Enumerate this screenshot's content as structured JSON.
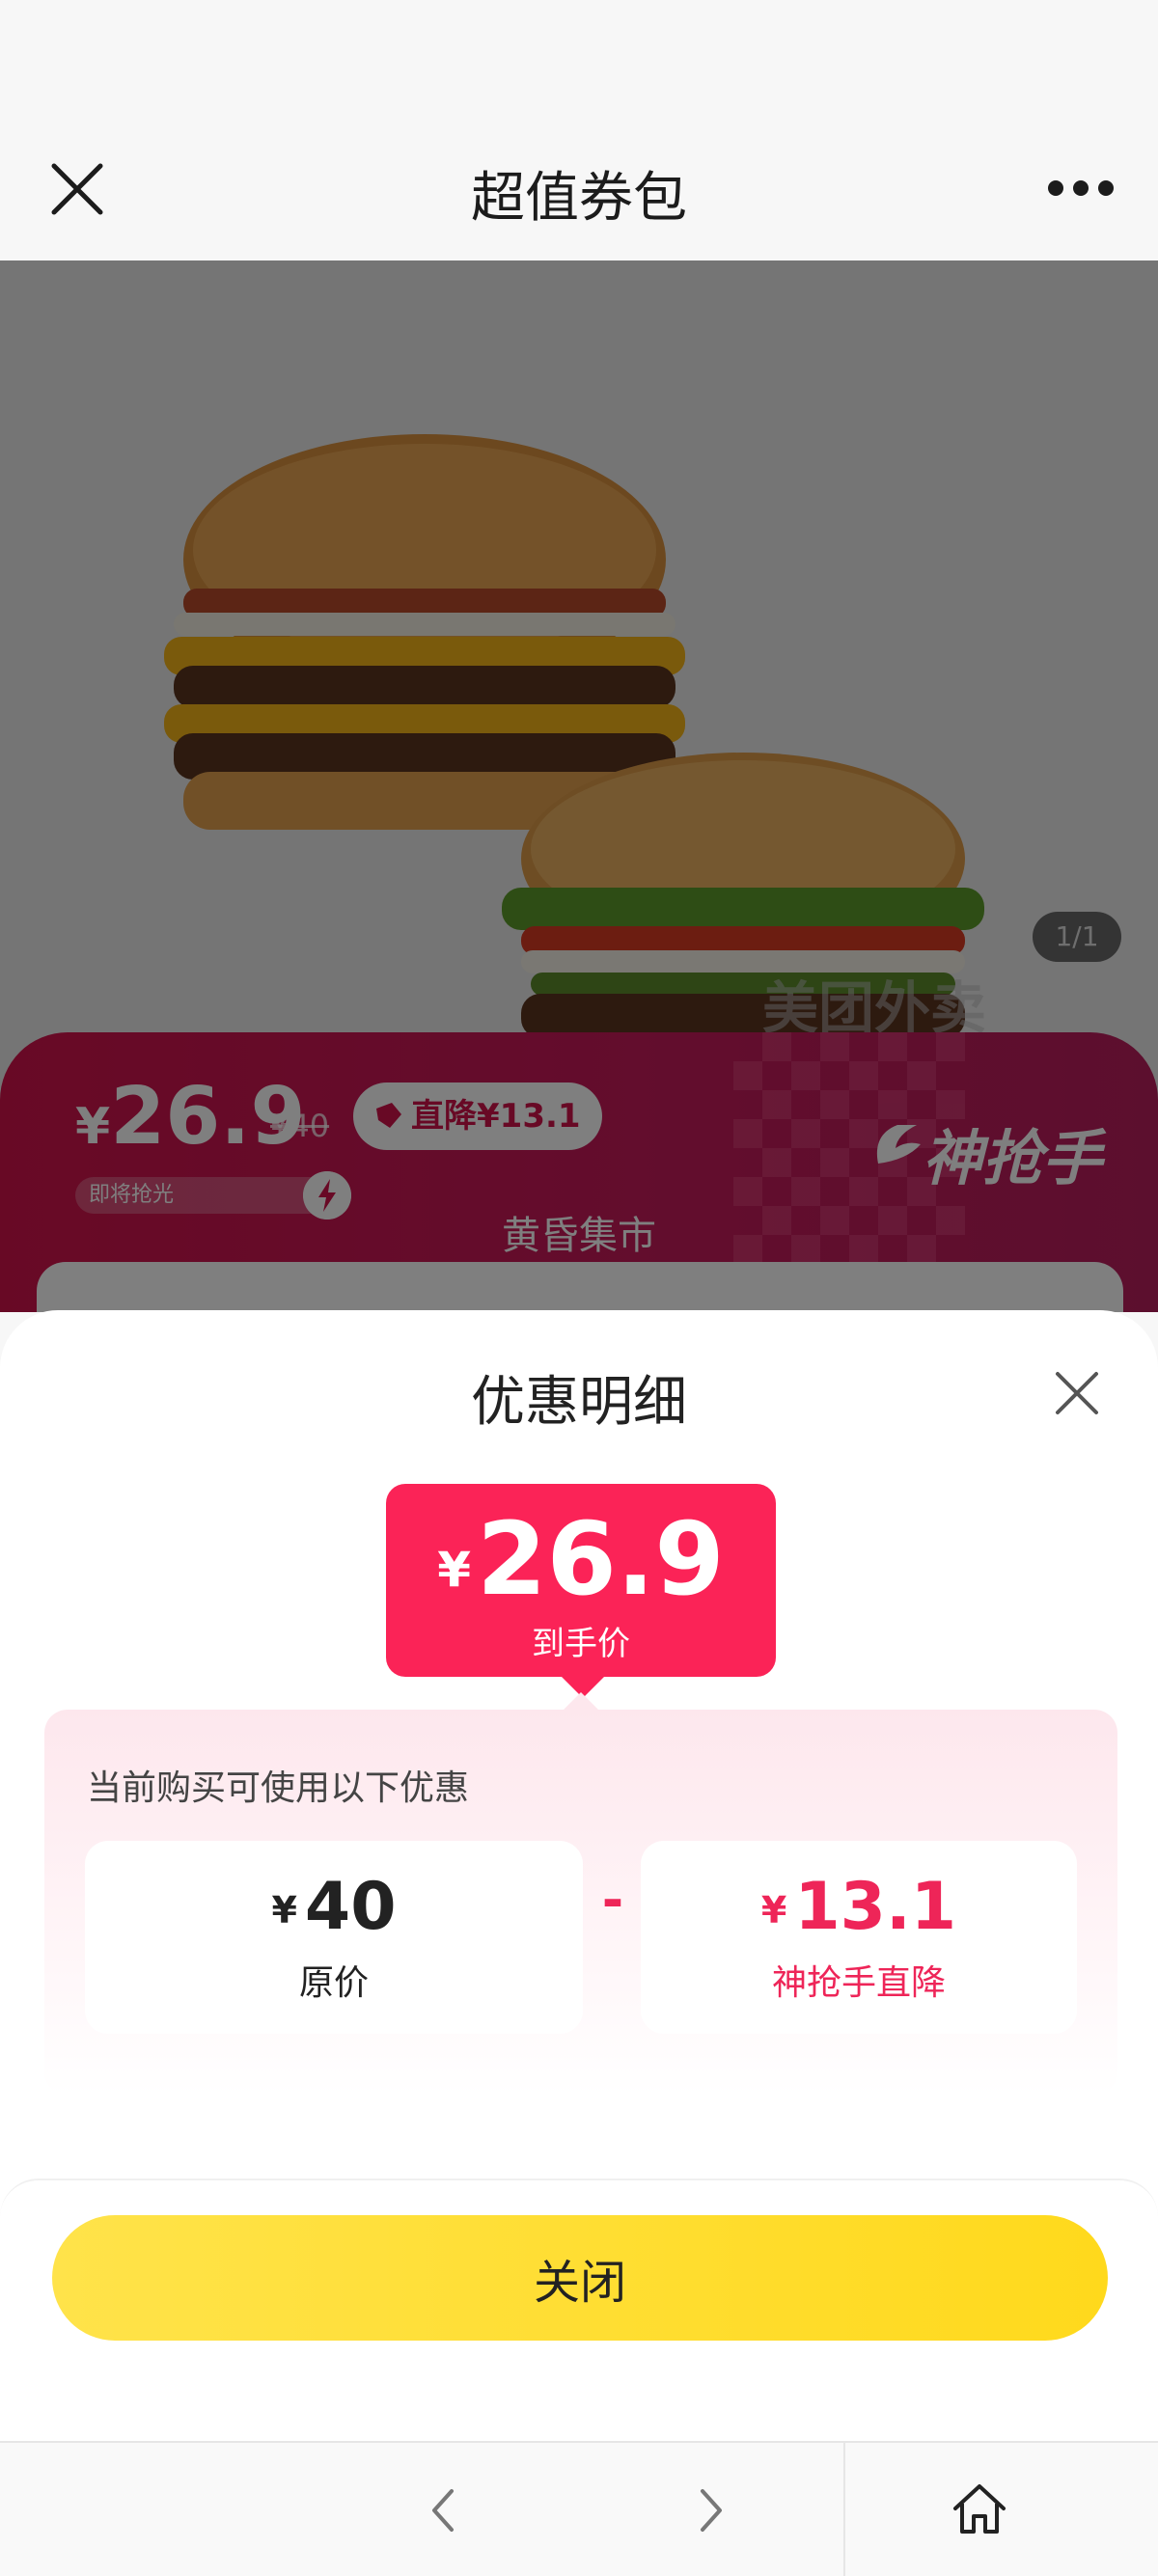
{
  "nav": {
    "title": "超值券包",
    "close_icon": "close-icon",
    "more_icon": "more-icon"
  },
  "product": {
    "image_alt": "burgers-image",
    "page_indicator": "1/1",
    "watermark": "美团外卖",
    "promo": {
      "currency": "¥",
      "price": "26.9",
      "original_price": "¥40",
      "badge": "直降¥13.1",
      "stock_hint": "即将抢光",
      "brand": "神抢手",
      "subtitle": "黄昏集市"
    }
  },
  "sheet": {
    "title": "优惠明细",
    "final": {
      "currency": "¥",
      "price": "26.9",
      "label": "到手价"
    },
    "details": {
      "title": "当前购买可使用以下优惠",
      "original": {
        "currency": "¥",
        "value": "40",
        "label": "原价"
      },
      "operator": "-",
      "discount": {
        "currency": "¥",
        "value": "13.1",
        "label": "神抢手直降"
      }
    },
    "close_button": "关闭"
  },
  "colors": {
    "accent_pink": "#fb2357",
    "promo_red": "#d1134b",
    "button_yellow": "#ffd91c"
  }
}
